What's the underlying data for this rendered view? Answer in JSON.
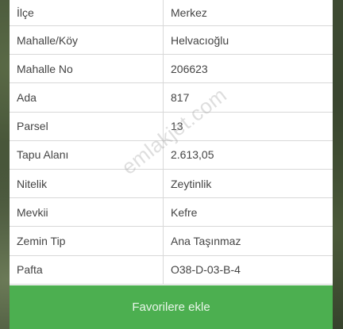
{
  "details": {
    "rows": [
      {
        "key": "İlçe",
        "value": "Merkez"
      },
      {
        "key": "Mahalle/Köy",
        "value": "Helvacıoğlu"
      },
      {
        "key": "Mahalle No",
        "value": "206623"
      },
      {
        "key": "Ada",
        "value": "817"
      },
      {
        "key": "Parsel",
        "value": "13"
      },
      {
        "key": "Tapu Alanı",
        "value": "2.613,05"
      },
      {
        "key": "Nitelik",
        "value": "Zeytinlik"
      },
      {
        "key": "Mevkii",
        "value": "Kefre"
      },
      {
        "key": "Zemin Tip",
        "value": "Ana Taşınmaz"
      },
      {
        "key": "Pafta",
        "value": "O38-D-03-B-4"
      }
    ]
  },
  "watermark": "emlakjet.com",
  "actions": {
    "favorite_label": "Favorilere ekle"
  },
  "colors": {
    "button": "#4caf50",
    "text": "#444444",
    "border": "#d8d8d8"
  }
}
